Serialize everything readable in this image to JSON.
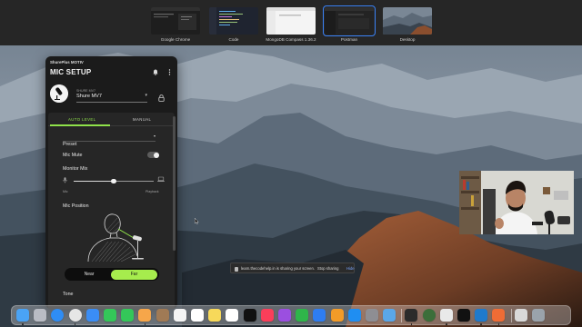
{
  "switcher": {
    "windows": [
      {
        "label": "Google Chrome",
        "active": false
      },
      {
        "label": "Code",
        "active": false
      },
      {
        "label": "MongoDB Compass 1.36.2",
        "active": false
      },
      {
        "label": "Postman",
        "active": true
      },
      {
        "label": "Desktop",
        "active": false
      }
    ]
  },
  "app": {
    "brand": "ShurePlus MOTIV",
    "title": "MIC SETUP",
    "device_caption": "SHURE MV7",
    "device_name": "Shure MV7",
    "tabs": [
      {
        "label": "AUTO LEVEL",
        "active": true
      },
      {
        "label": "MANUAL",
        "active": false
      }
    ],
    "preset_label": "Preset",
    "mic_mute_label": "Mic Mute",
    "mic_mute_on": false,
    "monitor_mix_label": "Monitor Mix",
    "monitor_mix_left": "Mic",
    "monitor_mix_right": "Playback",
    "monitor_mix_level": 0.5,
    "mic_position_label": "Mic Position",
    "distance_options": [
      "Near",
      "Far"
    ],
    "distance_selected": "Far",
    "tone_label": "Tone"
  },
  "share_notice": {
    "text": "learn.thecodehelp.in is sharing your screen.",
    "stop_label": "Stop sharing",
    "hide_label": "Hide"
  },
  "colors": {
    "accent_green": "#8fe24a",
    "far_button": "#a6ec4d",
    "panel_bg": "#1b1b1b",
    "active_outline": "#3a82f7"
  },
  "dock": {
    "apps": [
      "finder-icon",
      "launchpad-icon",
      "safari-icon",
      "chrome-icon",
      "mail-icon",
      "facetime-icon",
      "messages-icon",
      "photos-icon",
      "contacts-icon",
      "calendar-icon",
      "reminders-icon",
      "notes-icon",
      "freeform-icon",
      "appletv-icon",
      "music-icon",
      "podcasts-icon",
      "numbers-icon",
      "keynote-icon",
      "pages-icon",
      "appstore-icon",
      "settings-icon",
      "preview-icon",
      "terminal-icon",
      "robo3t-icon",
      "mongodb-icon",
      "motiv-icon",
      "vscode-icon",
      "postman-icon",
      "preview2-icon",
      "trash-icon"
    ]
  }
}
